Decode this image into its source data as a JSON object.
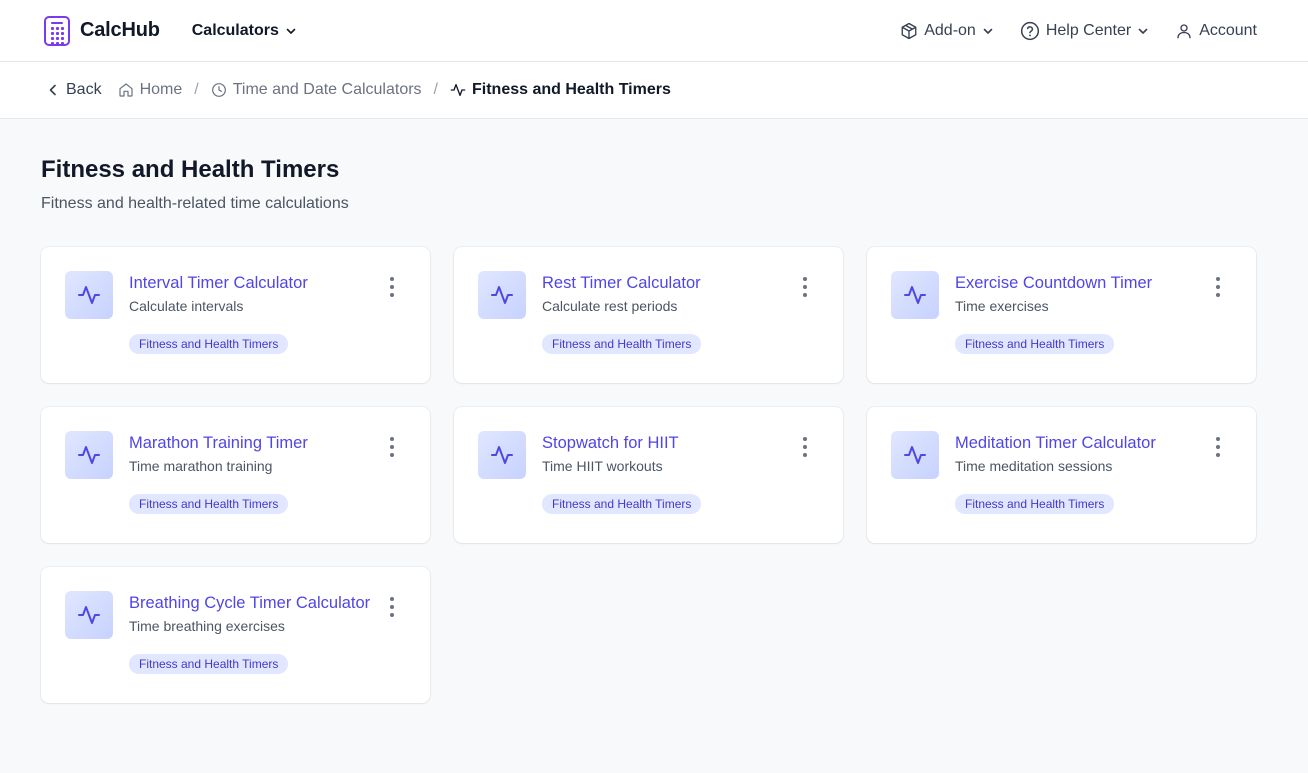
{
  "header": {
    "brand": "CalcHub",
    "calculators_label": "Calculators",
    "addon_label": "Add-on",
    "help_label": "Help Center",
    "account_label": "Account"
  },
  "breadcrumb": {
    "back": "Back",
    "home": "Home",
    "category": "Time and Date Calculators",
    "current": "Fitness and Health Timers"
  },
  "page": {
    "title": "Fitness and Health Timers",
    "subtitle": "Fitness and health-related time calculations"
  },
  "cards": [
    {
      "title": "Interval Timer Calculator",
      "desc": "Calculate intervals",
      "tag": "Fitness and Health Timers"
    },
    {
      "title": "Rest Timer Calculator",
      "desc": "Calculate rest periods",
      "tag": "Fitness and Health Timers"
    },
    {
      "title": "Exercise Countdown Timer",
      "desc": "Time exercises",
      "tag": "Fitness and Health Timers"
    },
    {
      "title": "Marathon Training Timer",
      "desc": "Time marathon training",
      "tag": "Fitness and Health Timers"
    },
    {
      "title": "Stopwatch for HIIT",
      "desc": "Time HIIT workouts",
      "tag": "Fitness and Health Timers"
    },
    {
      "title": "Meditation Timer Calculator",
      "desc": "Time meditation sessions",
      "tag": "Fitness and Health Timers"
    },
    {
      "title": "Breathing Cycle Timer Calculator",
      "desc": "Time breathing exercises",
      "tag": "Fitness and Health Timers"
    }
  ],
  "colors": {
    "accent": "#4f46e5",
    "brand": "#7c3aed",
    "tag_bg": "#e0e7ff",
    "page_bg": "#f8f9fb"
  },
  "icons": {
    "brand": "calculator-icon",
    "card": "activity-icon",
    "addon": "package-icon",
    "help": "help-circle-icon",
    "account": "user-icon",
    "home": "home-icon",
    "category": "clock-icon",
    "more": "more-vertical-icon"
  }
}
